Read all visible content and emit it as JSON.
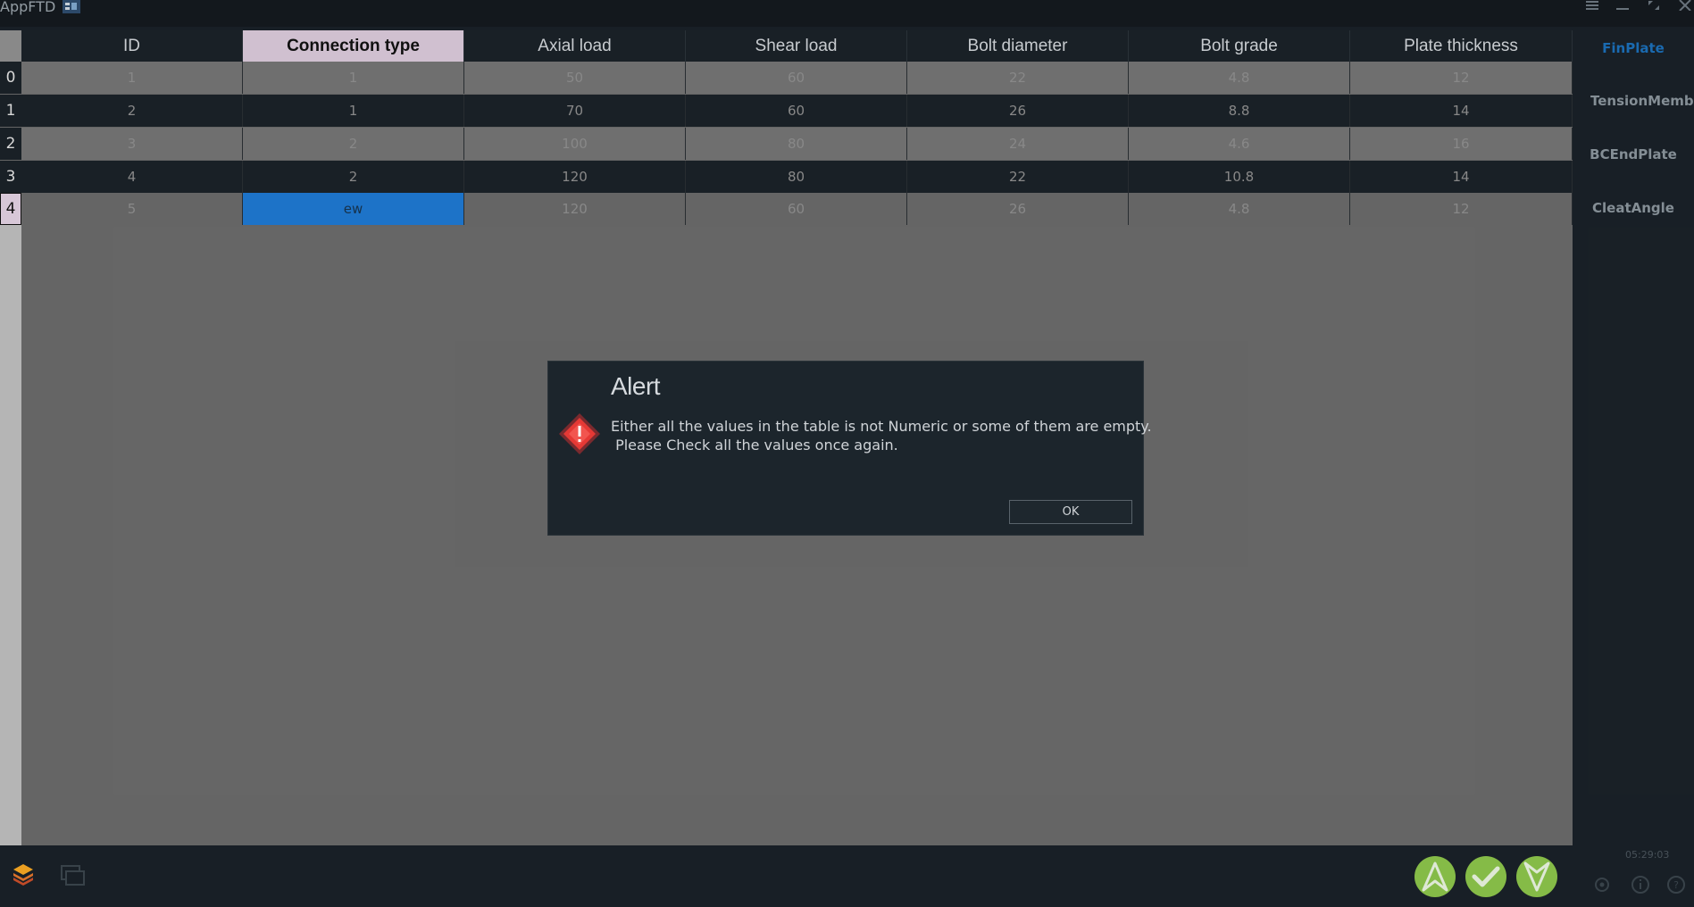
{
  "window": {
    "title": "AppFTD",
    "controls": [
      "menu",
      "minimize",
      "maximize",
      "close"
    ]
  },
  "table": {
    "columns": [
      "ID",
      "Connection type",
      "Axial load",
      "Shear load",
      "Bolt diameter",
      "Bolt grade",
      "Plate thickness"
    ],
    "selected_column": "Connection type",
    "row_headers": [
      "0",
      "1",
      "2",
      "3",
      "4"
    ],
    "selected_row": "4",
    "rows": [
      [
        "1",
        "1",
        "50",
        "60",
        "22",
        "4.8",
        "12"
      ],
      [
        "2",
        "1",
        "70",
        "60",
        "26",
        "8.8",
        "14"
      ],
      [
        "3",
        "2",
        "100",
        "80",
        "24",
        "4.6",
        "16"
      ],
      [
        "4",
        "2",
        "120",
        "80",
        "22",
        "10.8",
        "14"
      ],
      [
        "5",
        "ew",
        "120",
        "60",
        "26",
        "4.8",
        "12"
      ]
    ],
    "selected_cell_value": "ew"
  },
  "side_panel": {
    "items": [
      "FinPlate",
      "TensionMember",
      "BCEndPlate",
      "CleatAngle"
    ],
    "active": "FinPlate"
  },
  "bottom_bar": {
    "clock": "05:29:03",
    "nav_buttons": [
      "up-arrow-icon",
      "check-icon",
      "down-arrow-icon"
    ],
    "accent": "#8bc34a"
  },
  "dialog": {
    "title": "Alert",
    "message_line1": "Either all the values in the table is not Numeric or some of them are empty.",
    "message_line2": " Please Check all the values once again.",
    "ok_label": "OK",
    "icon": "warning-diamond-icon",
    "icon_color": "#e53935"
  }
}
